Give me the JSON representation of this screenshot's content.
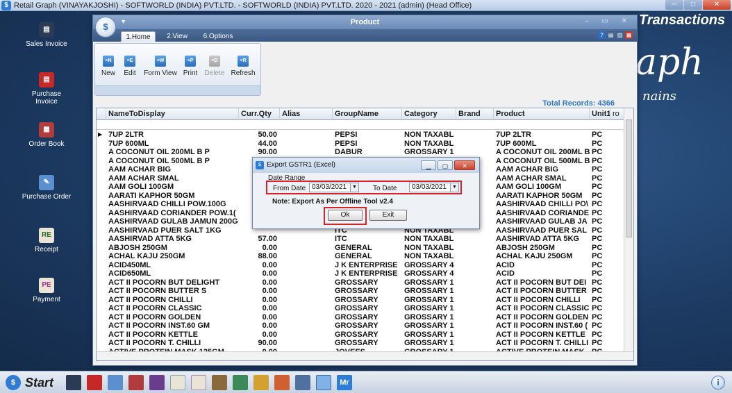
{
  "app": {
    "title": "Retail Graph (VINAYAKJOSHI) - SOFTWORLD (INDIA) PVT.LTD. - SOFTWORLD (INDIA) PVT.LTD.  2020 - 2021 (admin) (Head Office)"
  },
  "desktop": {
    "icons": [
      "Sales Invoice",
      "Purchase Invoice",
      "Order Book",
      "Purchase Order",
      "Receipt",
      "Payment"
    ],
    "brand_transactions": "Transactions",
    "brand_graph": "aph",
    "brand_tagline": "nains"
  },
  "window": {
    "title": "Product",
    "tabs": [
      "1.Home",
      "2.View",
      "6.Options"
    ],
    "ribbon": [
      "New",
      "Edit",
      "Form View",
      "Print",
      "Delete",
      "Refresh"
    ],
    "total_records": "Total Records: 4366"
  },
  "grid": {
    "columns": [
      "NameToDisplay",
      "Curr.Qty",
      "Alias",
      "GroupName",
      "Category",
      "Brand",
      "Product",
      "Unit1",
      "ro"
    ],
    "rows": [
      [
        "7UP 2LTR",
        "50.00",
        "",
        "PEPSI",
        "NON TAXABL",
        "",
        "7UP 2LTR",
        "PC"
      ],
      [
        "7UP 600ML",
        "44.00",
        "",
        "PEPSI",
        "NON TAXABL",
        "",
        "7UP 600ML",
        "PC"
      ],
      [
        "A COCONUT OIL 200ML B P",
        "90.00",
        "",
        "DABUR",
        "GROSSARY 1",
        "",
        "A COCONUT OIL 200ML B",
        "PC"
      ],
      [
        "A COCONUT OIL 500ML B P",
        "",
        "",
        "",
        "",
        "",
        "A COCONUT OIL 500ML B",
        "PC"
      ],
      [
        "AAM ACHAR BIG",
        "",
        "",
        "",
        "",
        "",
        "AAM ACHAR BIG",
        "PC"
      ],
      [
        "AAM ACHAR SMAL",
        "",
        "",
        "",
        "",
        "",
        "AAM ACHAR SMAL",
        "PC"
      ],
      [
        "AAM GOLI 100GM",
        "",
        "",
        "",
        "",
        "",
        "AAM GOLI 100GM",
        "PC"
      ],
      [
        "AARATI KAPHOR 50GM",
        "",
        "",
        "",
        "",
        "",
        "AARATI KAPHOR 50GM",
        "PC"
      ],
      [
        "AASHIRVAAD CHILLI POW.100G",
        "",
        "",
        "",
        "",
        "",
        "AASHIRVAAD CHILLI PO\\",
        "PC"
      ],
      [
        "AASHIRVAAD CORIANDER POW.1(",
        "",
        "",
        "",
        "",
        "",
        "AASHIRVAAD CORIANDE",
        "PC"
      ],
      [
        "AASHIRVAAD GULAB JAMUN 200G",
        "",
        "",
        "",
        "",
        "",
        "AASHIRVAAD GULAB JA",
        "PC"
      ],
      [
        "AASHIRVAAD PUER SALT 1KG",
        "",
        "",
        "ITC",
        "NON TAXABL",
        "",
        "AASHIRVAAD PUER SAL",
        "PC"
      ],
      [
        "AASHIRVAD ATTA 5KG",
        "57.00",
        "",
        "ITC",
        "NON TAXABL",
        "",
        "AASHIRVAD ATTA 5KG",
        "PC"
      ],
      [
        "ABJOSH 250GM",
        "0.00",
        "",
        "GENERAL",
        "NON TAXABL",
        "",
        "ABJOSH 250GM",
        "PC"
      ],
      [
        "ACHAL KAJU 250GM",
        "88.00",
        "",
        "GENERAL",
        "NON TAXABL",
        "",
        "ACHAL KAJU 250GM",
        "PC"
      ],
      [
        "ACID450ML",
        "0.00",
        "",
        "J K ENTERPRISE",
        "GROSSARY 4",
        "",
        "ACID",
        "PC"
      ],
      [
        "ACID650ML",
        "0.00",
        "",
        "J K ENTERPRISE",
        "GROSSARY 4",
        "",
        "ACID",
        "PC"
      ],
      [
        "ACT II POCORN BUT DELIGHT",
        "0.00",
        "",
        "GROSSARY",
        "GROSSARY 1",
        "",
        "ACT II POCORN BUT DEI",
        "PC"
      ],
      [
        "ACT II POCORN BUTTER S",
        "0.00",
        "",
        "GROSSARY",
        "GROSSARY 1",
        "",
        "ACT II POCORN BUTTER",
        "PC"
      ],
      [
        "ACT II POCORN CHILLI",
        "0.00",
        "",
        "GROSSARY",
        "GROSSARY 1",
        "",
        "ACT II POCORN CHILLI",
        "PC"
      ],
      [
        "ACT II POCORN CLASSIC",
        "0.00",
        "",
        "GROSSARY",
        "GROSSARY 1",
        "",
        "ACT II POCORN CLASSIC",
        "PC"
      ],
      [
        "ACT II POCORN GOLDEN",
        "0.00",
        "",
        "GROSSARY",
        "GROSSARY 1",
        "",
        "ACT II POCORN GOLDEN",
        "PC"
      ],
      [
        "ACT II POCORN INST.60 GM",
        "0.00",
        "",
        "GROSSARY",
        "GROSSARY 1",
        "",
        "ACT II POCORN INST.60 (",
        "PC"
      ],
      [
        "ACT II POCORN KETTLE",
        "0.00",
        "",
        "GROSSARY",
        "GROSSARY 1",
        "",
        "ACT II POCORN KETTLE",
        "PC"
      ],
      [
        "ACT II POCORN T. CHILLI",
        "90.00",
        "",
        "GROSSARY",
        "GROSSARY 1",
        "",
        "ACT II POCORN T. CHILLI",
        "PC"
      ],
      [
        "ACTIVE PROTEIN MASK 125GM",
        "0.00",
        "",
        "JOVEES",
        "GROSSARY 1",
        "",
        "ACTIVE PROTEIN MASK",
        "PC"
      ]
    ]
  },
  "dialog": {
    "title": "Export GSTR1 (Excel)",
    "date_range_label": "Date Range",
    "from_label": "From Date",
    "from_value": "03/03/2021",
    "to_label": "To Date",
    "to_value": "03/03/2021",
    "note": "Note: Export As Per Offline Tool v2.4",
    "ok_label": "Ok",
    "exit_label": "Exit"
  },
  "taskbar": {
    "start_label": "Start",
    "info_label": "i",
    "mr_label": "Mr"
  }
}
